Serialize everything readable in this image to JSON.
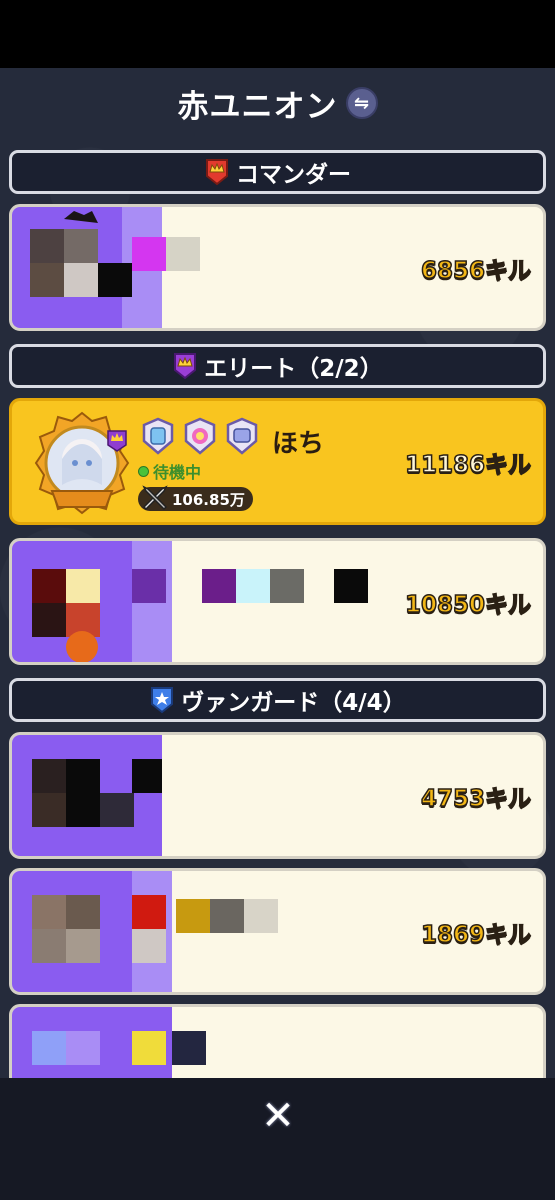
{
  "window": {
    "title": "赤ユニオン",
    "swap_icon": "⇋"
  },
  "sections": {
    "commander": {
      "label": "コマンダー"
    },
    "elite": {
      "label": "エリート（2/2）"
    },
    "vanguard": {
      "label": "ヴァンガード（4/4）"
    }
  },
  "members": [
    {
      "kills": "6856キル",
      "censored": true
    },
    {
      "name": "ほち",
      "status": "待機中",
      "power": "106.85万",
      "kills": "11186キル",
      "highlight": true
    },
    {
      "kills": "10850キル",
      "censored": true
    },
    {
      "kills": "4753キル",
      "censored": true
    },
    {
      "kills": "1869キル",
      "censored": true
    },
    {
      "kills": "",
      "censored": true
    }
  ],
  "footer": {
    "close_glyph": "✕"
  },
  "colors": {
    "panel_bg": "#252b3b",
    "card_bg": "#fcf8e6",
    "highlight_bg": "#f9c51f",
    "kill_text": "#f3b716",
    "censor_purple": "#7a4ae8"
  }
}
